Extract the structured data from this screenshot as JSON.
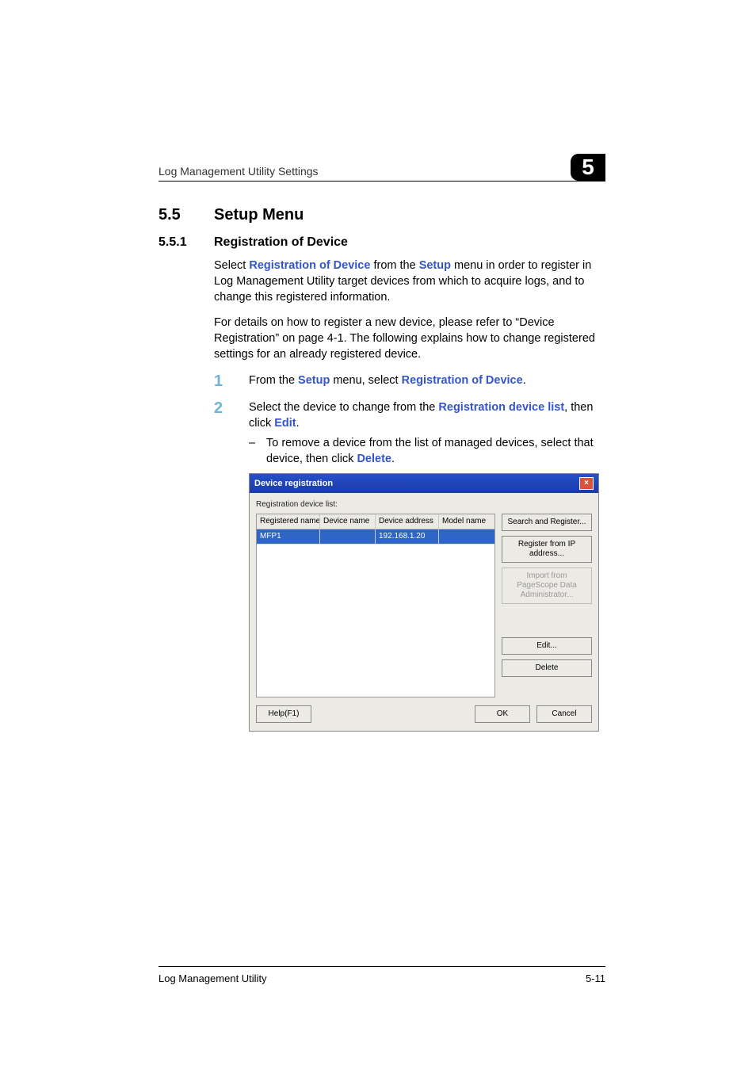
{
  "header": {
    "running_head": "Log Management Utility Settings",
    "chapter_number": "5"
  },
  "section": {
    "number": "5.5",
    "title": "Setup Menu"
  },
  "subsection": {
    "number": "5.5.1",
    "title": "Registration of Device"
  },
  "paragraphs": {
    "p1_a": "Select ",
    "p1_link1": "Registration of Device",
    "p1_b": " from the ",
    "p1_link2": "Setup",
    "p1_c": " menu in order to register in Log Management Utility target devices from which to acquire logs, and to change this registered information.",
    "p2": "For details on how to register a new device, please refer to “Device Registration” on page 4-1. The following explains how to change registered settings for an already registered device."
  },
  "steps": {
    "s1_num": "1",
    "s1_a": "From the ",
    "s1_link1": "Setup",
    "s1_b": " menu, select ",
    "s1_link2": "Registration of Device",
    "s1_c": ".",
    "s2_num": "2",
    "s2_a": "Select the device to change from the ",
    "s2_link1": "Registration device list",
    "s2_b": ", then click ",
    "s2_link2": "Edit",
    "s2_c": ".",
    "bullet_dash": "–",
    "bullet_a": "To remove a device from the list of managed devices, select that device, then click ",
    "bullet_link": "Delete",
    "bullet_b": "."
  },
  "dialog": {
    "title": "Device registration",
    "close": "×",
    "list_label": "Registration device list:",
    "columns": {
      "c1": "Registered name",
      "c2": "Device name",
      "c3": "Device address",
      "c4": "Model name"
    },
    "row1": {
      "registered_name": "MFP1",
      "device_name": "",
      "device_address": "192.168.1.20",
      "model_name": ""
    },
    "buttons": {
      "search": "Search and Register...",
      "register_ip": "Register from IP address...",
      "import": "Import from PageScope Data Administrator...",
      "edit": "Edit...",
      "delete": "Delete",
      "help": "Help(F1)",
      "ok": "OK",
      "cancel": "Cancel"
    }
  },
  "footer": {
    "doc_title": "Log Management Utility",
    "page_num": "5-11"
  }
}
